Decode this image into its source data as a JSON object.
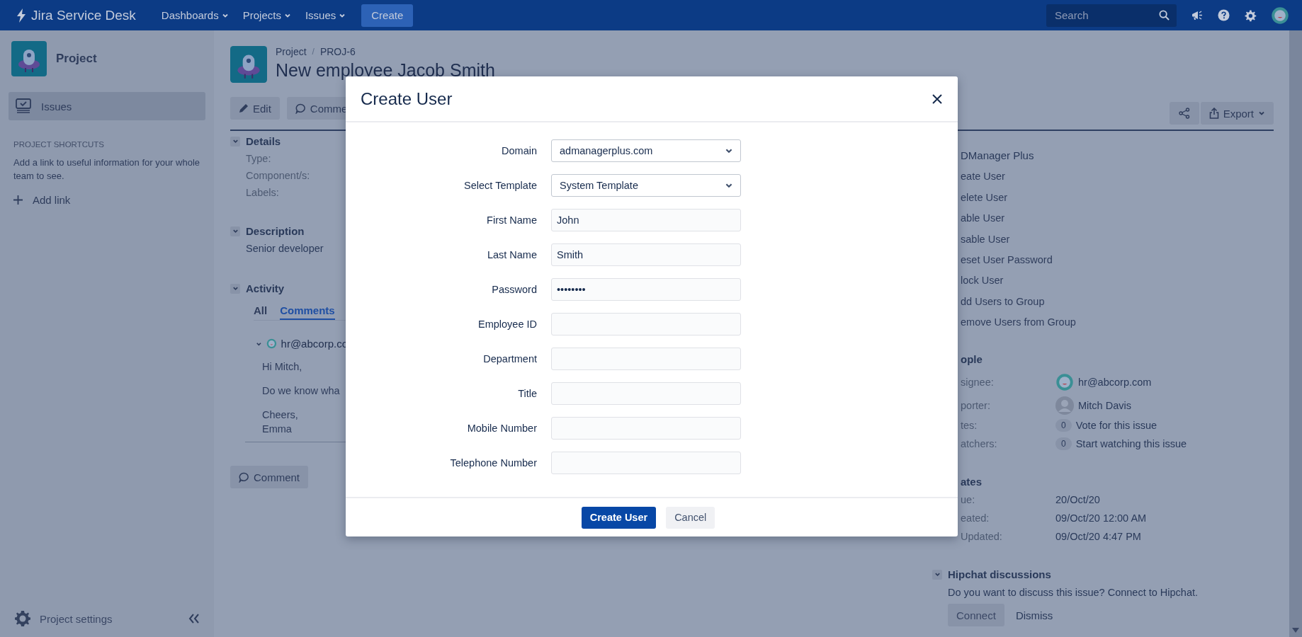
{
  "nav": {
    "product": "Jira Service Desk",
    "menus": [
      {
        "label": "Dashboards"
      },
      {
        "label": "Projects"
      },
      {
        "label": "Issues"
      }
    ],
    "create": "Create",
    "search": {
      "placeholder": "Search"
    }
  },
  "sidebar": {
    "project": "Project",
    "items": [
      {
        "label": "Issues",
        "selected": true
      }
    ],
    "shortcuts_heading": "PROJECT SHORTCUTS",
    "shortcuts_text": "Add a link to useful information for your whole team to see.",
    "add_link": "Add link",
    "settings": "Project settings"
  },
  "issue": {
    "breadcrumbs": [
      "Project",
      "PROJ-6"
    ],
    "breadcrumb_separator": "/",
    "title": "New employee Jacob Smith",
    "actions": [
      "Edit",
      "Comme"
    ],
    "export": "Export",
    "details": {
      "heading": "Details",
      "fields": [
        "Type:",
        "Component/s:",
        "Labels:"
      ]
    },
    "description": {
      "heading": "Description",
      "text": "Senior developer"
    },
    "activity": {
      "heading": "Activity",
      "tabs": [
        {
          "label": "All",
          "selected": false
        },
        {
          "label": "Comments",
          "selected": true
        }
      ],
      "author": "hr@abcorp.co",
      "lines": [
        "Hi Mitch,",
        "Do we know wha",
        "Cheers,\nEmma"
      ]
    },
    "comment_button": "Comment"
  },
  "right": {
    "addon": {
      "heading": "DManager Plus",
      "items": [
        "eate User",
        "elete User",
        "able User",
        "sable User",
        "eset User Password",
        "lock User",
        "dd Users to Group",
        "emove Users from Group"
      ]
    },
    "people": {
      "heading": "ople",
      "rows": [
        {
          "kind": "avatar",
          "label": "signee:",
          "value": "hr@abcorp.com"
        },
        {
          "kind": "person",
          "label": "porter:",
          "value": "Mitch Davis"
        },
        {
          "kind": "count",
          "label": "tes:",
          "count": "0",
          "value": "Vote for this issue"
        },
        {
          "kind": "count",
          "label": "atchers:",
          "count": "0",
          "value": "Start watching this issue"
        }
      ]
    },
    "dates": {
      "heading": "ates",
      "rows": [
        {
          "label": "ue:",
          "value": "20/Oct/20"
        },
        {
          "label": "eated:",
          "value": "09/Oct/20 12:00 AM"
        },
        {
          "label": "Updated:",
          "value": "09/Oct/20 4:47 PM"
        }
      ]
    },
    "hipchat": {
      "heading": "Hipchat discussions",
      "text": "Do you want to discuss this issue? Connect to Hipchat.",
      "buttons": [
        "Connect",
        "Dismiss"
      ]
    }
  },
  "dialog": {
    "title": "Create User",
    "fields": [
      {
        "kind": "select",
        "label": "Domain",
        "value": "admanagerplus.com"
      },
      {
        "kind": "select",
        "label": "Select Template",
        "value": "System Template"
      },
      {
        "kind": "text",
        "label": "First Name",
        "value": "John"
      },
      {
        "kind": "text",
        "label": "Last Name",
        "value": "Smith"
      },
      {
        "kind": "text",
        "label": "Password",
        "value": "••••••••"
      },
      {
        "kind": "text",
        "label": "Employee ID"
      },
      {
        "kind": "text",
        "label": "Department"
      },
      {
        "kind": "text",
        "label": "Title"
      },
      {
        "kind": "text",
        "label": "Mobile Number"
      },
      {
        "kind": "text",
        "label": "Telephone Number"
      }
    ],
    "buttons": [
      {
        "kind": "primary",
        "label": "Create User"
      },
      {
        "kind": "secondary",
        "label": "Cancel"
      }
    ]
  }
}
